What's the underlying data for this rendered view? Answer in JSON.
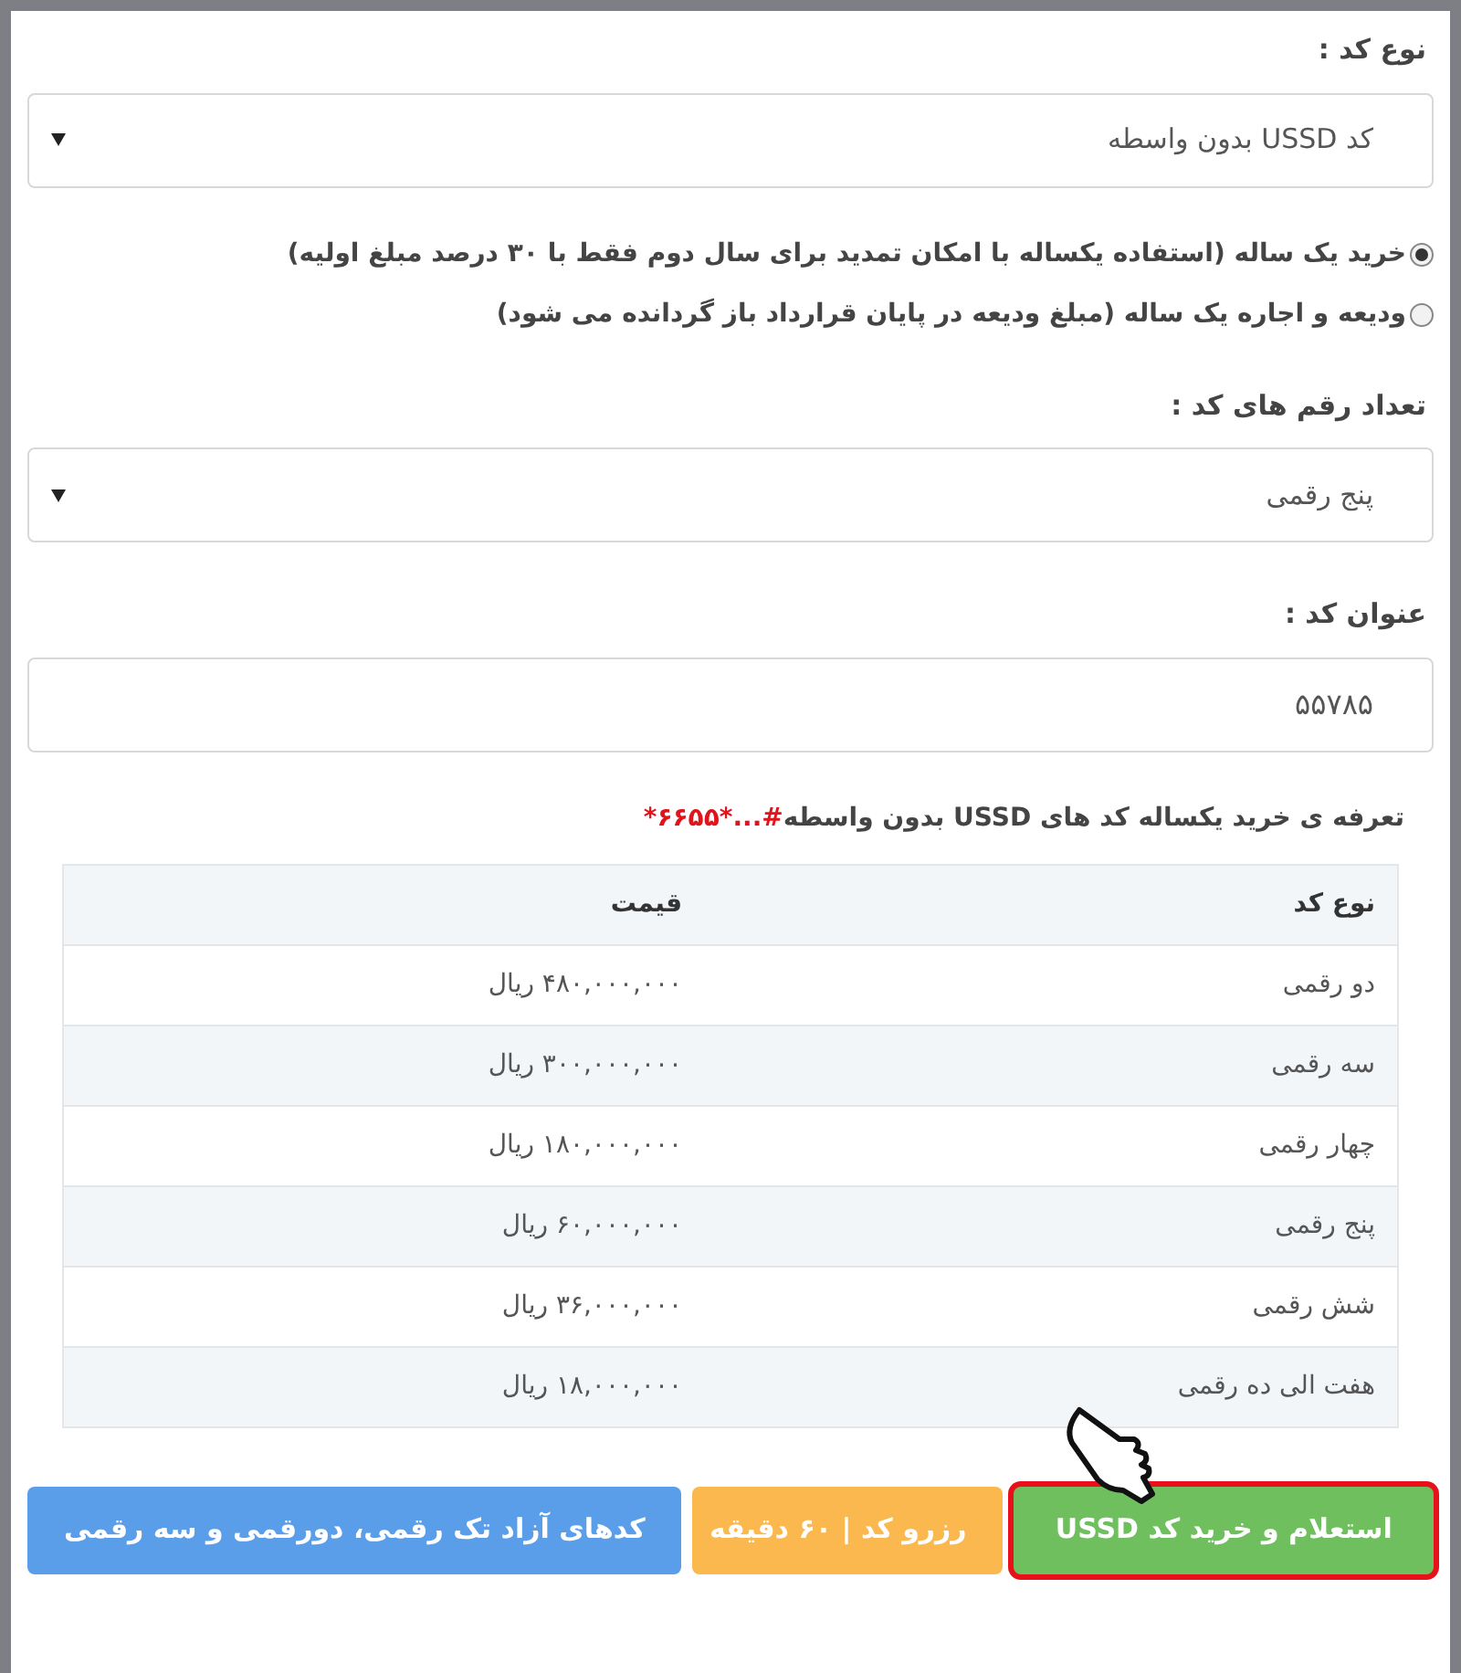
{
  "code_type": {
    "label": "نوع کد :",
    "value": "کد USSD بدون واسطه"
  },
  "plans": [
    {
      "label": "خرید یک ساله (استفاده یکساله با امکان تمدید برای سال دوم فقط با ۳۰ درصد مبلغ اولیه)",
      "selected": true
    },
    {
      "label": "ودیعه و اجاره یک ساله (مبلغ ودیعه در پایان قرارداد باز گردانده می شود)",
      "selected": false
    }
  ],
  "digits": {
    "label": "تعداد رقم های کد :",
    "value": "پنج رقمی"
  },
  "code_title": {
    "label": "عنوان کد :",
    "value": "۵۵۷۸۵"
  },
  "tariff": {
    "title": "تعرفه ی خرید یکساله کد های USSD بدون واسطه",
    "code": "*۶۶۵۵*...#"
  },
  "table": {
    "columns": [
      "نوع کد",
      "قیمت"
    ],
    "rows": [
      [
        "دو رقمی",
        "۴۸۰,۰۰۰,۰۰۰ ریال"
      ],
      [
        "سه رقمی",
        "۳۰۰,۰۰۰,۰۰۰ ریال"
      ],
      [
        "چهار رقمی",
        "۱۸۰,۰۰۰,۰۰۰ ریال"
      ],
      [
        "پنج رقمی",
        "۶۰,۰۰۰,۰۰۰ ریال"
      ],
      [
        "شش رقمی",
        "۳۶,۰۰۰,۰۰۰ ریال"
      ],
      [
        "هفت الی ده رقمی",
        "۱۸,۰۰۰,۰۰۰ ریال"
      ]
    ]
  },
  "buttons": [
    {
      "label": "استعلام و خرید کد USSD",
      "kind": "success",
      "highlighted": true
    },
    {
      "label": "رزرو کد | ۶۰ دقیقه",
      "kind": "warning",
      "highlighted": false
    },
    {
      "label": "کدهای آزاد تک رقمی، دورقمی و سه رقمی",
      "kind": "info",
      "highlighted": false
    }
  ]
}
